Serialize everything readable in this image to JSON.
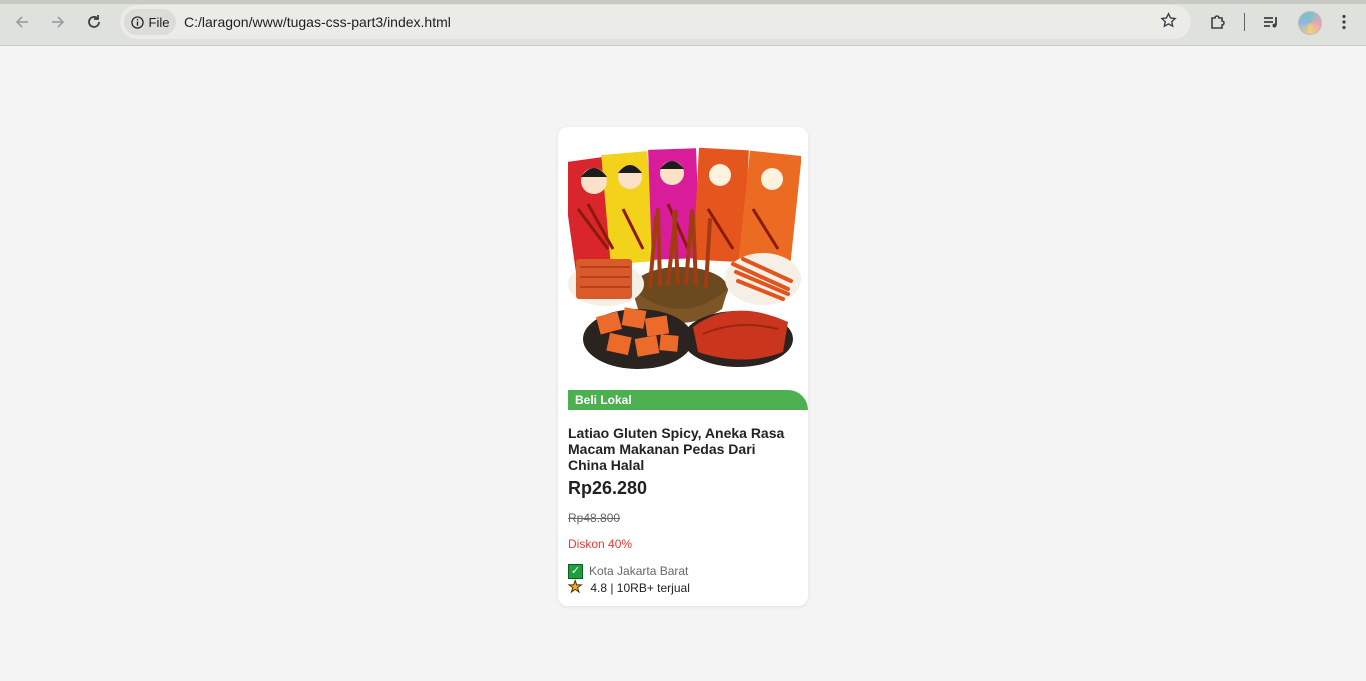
{
  "browser": {
    "back_icon": "arrow-left-icon",
    "forward_icon": "arrow-right-icon",
    "reload_icon": "reload-icon",
    "site_info_label": "File",
    "url": "C:/laragon/www/tugas-css-part3/index.html",
    "bookmark_icon": "star-outline-icon",
    "extensions_icon": "puzzle-icon",
    "media_icon": "playlist-icon",
    "menu_icon": "kebab-menu-icon"
  },
  "product": {
    "badge": "Beli Lokal",
    "title": "Latiao Gluten Spicy, Aneka Rasa Macam Makanan Pedas Dari China Halal",
    "price": "Rp26.280",
    "original_price": "Rp48.800",
    "discount": "Diskon 40%",
    "location": "Kota Jakarta Barat",
    "rating_sold": "4.8 | 10RB+ terjual"
  },
  "colors": {
    "badge_bg": "#4caf50",
    "discount_text": "#e53935",
    "page_bg": "#f4f4f4"
  }
}
